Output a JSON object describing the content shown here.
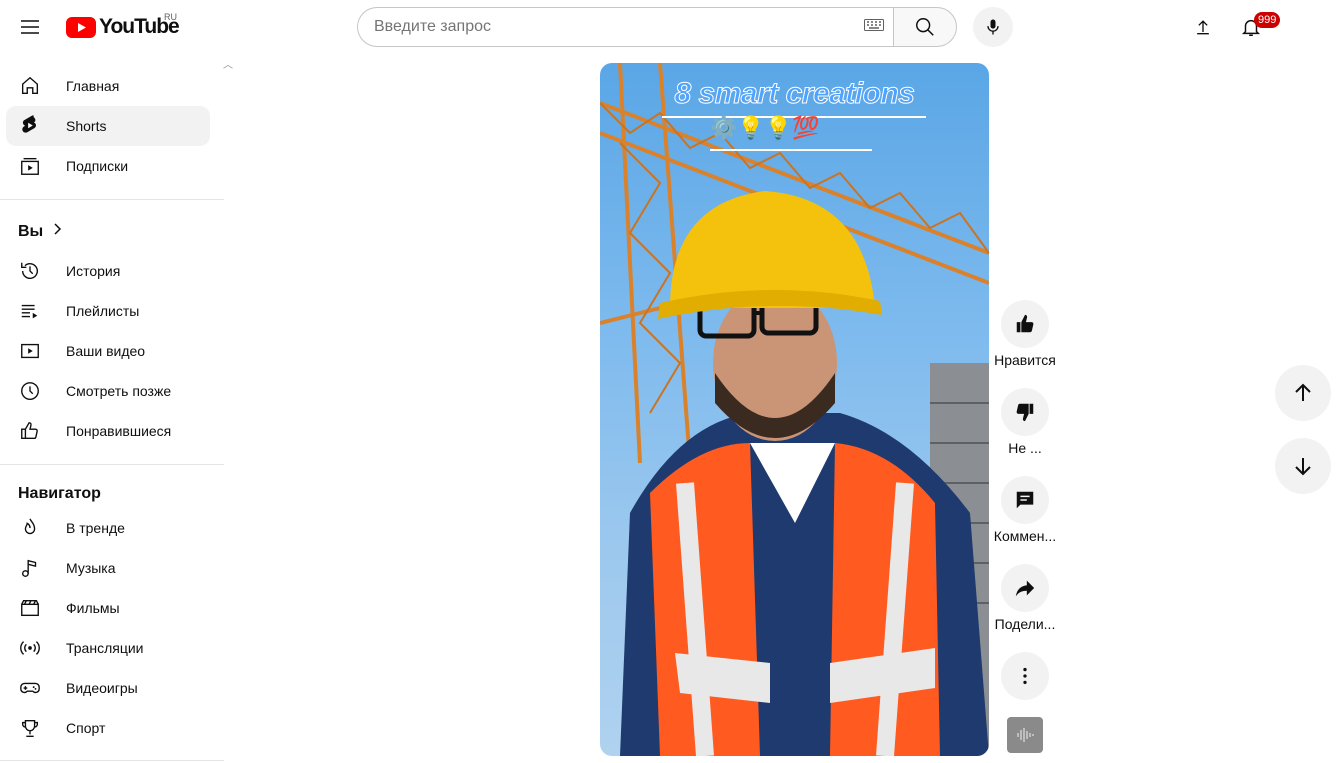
{
  "header": {
    "logo_text": "YouTube",
    "country_code": "RU",
    "search_placeholder": "Введите запрос",
    "notification_count": "999"
  },
  "sidebar": {
    "main_items": [
      {
        "label": "Главная",
        "icon": "home-icon"
      },
      {
        "label": "Shorts",
        "icon": "shorts-icon",
        "active": true
      },
      {
        "label": "Подписки",
        "icon": "subscriptions-icon"
      }
    ],
    "you_title": "Вы",
    "you_items": [
      {
        "label": "История",
        "icon": "history-icon"
      },
      {
        "label": "Плейлисты",
        "icon": "playlists-icon"
      },
      {
        "label": "Ваши видео",
        "icon": "your-videos-icon"
      },
      {
        "label": "Смотреть позже",
        "icon": "watch-later-icon"
      },
      {
        "label": "Понравившиеся",
        "icon": "liked-icon"
      }
    ],
    "navigator_title": "Навигатор",
    "navigator_items": [
      {
        "label": "В тренде",
        "icon": "trending-icon"
      },
      {
        "label": "Музыка",
        "icon": "music-icon"
      },
      {
        "label": "Фильмы",
        "icon": "movies-icon"
      },
      {
        "label": "Трансляции",
        "icon": "live-icon"
      },
      {
        "label": "Видеоигры",
        "icon": "gaming-icon"
      },
      {
        "label": "Спорт",
        "icon": "sports-icon"
      }
    ]
  },
  "video": {
    "overlay_title": "8 smart creations",
    "overlay_emojis": "⚙️💡💡💯"
  },
  "actions": {
    "like_label": "Нравится",
    "dislike_label": "Не ...",
    "comments_label": "Коммен...",
    "share_label": "Подели..."
  },
  "colors": {
    "brand_red": "#ff0000",
    "badge_red": "#cc0000",
    "active_bg": "#f2f2f2"
  }
}
